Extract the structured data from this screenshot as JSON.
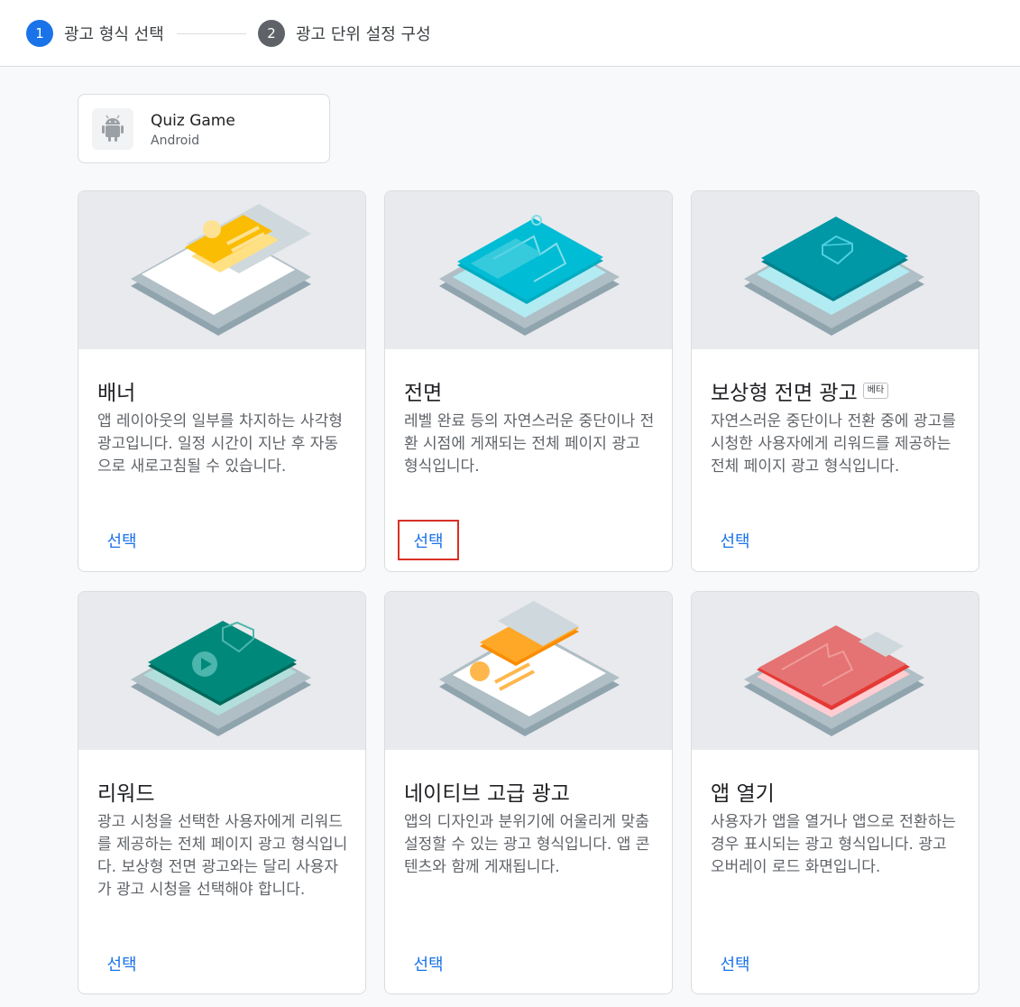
{
  "stepper": {
    "steps": [
      {
        "number": "1",
        "label": "광고 형식 선택",
        "state": "active"
      },
      {
        "number": "2",
        "label": "광고 단위 설정 구성",
        "state": "inactive"
      }
    ],
    "active_color": "#1a73e8",
    "inactive_color": "#5f6368"
  },
  "app": {
    "name": "Quiz Game",
    "platform": "Android",
    "icon": "android-icon"
  },
  "formats": [
    {
      "title": "배너",
      "description": "앱 레이아웃의 일부를 차지하는 사각형 광고입니다. 일정 시간이 지난 후 자동으로 새로고침될 수 있습니다.",
      "select_label": "선택",
      "illustration": "banner-illustration"
    },
    {
      "title": "전면",
      "description": "레벨 완료 등의 자연스러운 중단이나 전환 시점에 게재되는 전체 페이지 광고 형식입니다.",
      "select_label": "선택",
      "illustration": "interstitial-illustration",
      "highlighted": true
    },
    {
      "title": "보상형 전면 광고",
      "badge": "베타",
      "description": "자연스러운 중단이나 전환 중에 광고를 시청한 사용자에게 리워드를 제공하는 전체 페이지 광고 형식입니다.",
      "select_label": "선택",
      "illustration": "rewarded-interstitial-illustration"
    },
    {
      "title": "리워드",
      "description": "광고 시청을 선택한 사용자에게 리워드를 제공하는 전체 페이지 광고 형식입니다. 보상형 전면 광고와는 달리 사용자가 광고 시청을 선택해야 합니다.",
      "select_label": "선택",
      "illustration": "rewarded-illustration"
    },
    {
      "title": "네이티브 고급 광고",
      "description": "앱의 디자인과 분위기에 어울리게 맞춤설정할 수 있는 광고 형식입니다. 앱 콘텐츠와 함께 게재됩니다.",
      "select_label": "선택",
      "illustration": "native-illustration"
    },
    {
      "title": "앱 열기",
      "description": "사용자가 앱을 열거나 앱으로 전환하는 경우 표시되는 광고 형식입니다. 광고 오버레이 로드 화면입니다.",
      "select_label": "선택",
      "illustration": "app-open-illustration"
    }
  ]
}
